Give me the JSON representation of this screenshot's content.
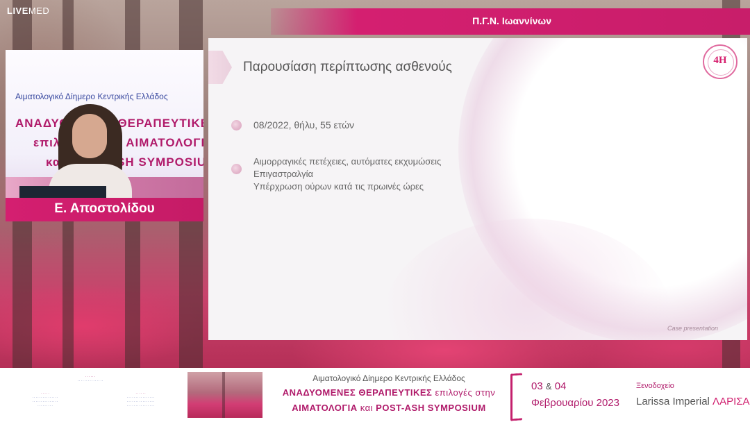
{
  "brand": {
    "bold": "LIVE",
    "light": "MED"
  },
  "header": {
    "hospital": "Π.Γ.Ν. Ιωαννίνων"
  },
  "presenter": {
    "name": "Ε. Αποστολίδου"
  },
  "webcam_poster": {
    "line1": "Αιματολογικό Δίημερο Κεντρικής Ελλάδος",
    "line2": "ΑΝΑΔΥΟΜΕΝΕΣ ΘΕΡΑΠΕΥΤΙΚΕΣ",
    "line3": "επιλογές στην ΑΙΜΑΤΟΛΟΓΙΑ",
    "line4": "και POST-ASH SYMPOSIUM"
  },
  "slide": {
    "title": "Παρουσίαση περίπτωσης ασθενούς",
    "logo_text": "4H",
    "bullet1": "08/2022, θήλυ, 55 ετών",
    "bullet2_lines": [
      "Αιμορραγικές πετέχειες, αυτόματες εκχυμώσεις",
      "Επιγαστραλγία",
      "Υπέρχρωση ούρων κατά τις πρωινές ώρες"
    ],
    "footer": "Case presentation"
  },
  "banner": {
    "subtitle": "Αιματολογικό Δίημερο Κεντρικής Ελλάδος",
    "main_line1_bold": "ΑΝΑΔΥΟΜΕΝΕΣ ΘΕΡΑΠΕΥΤΙΚΕΣ",
    "main_line1_thin": "επιλογές στην",
    "main_line2_a": "ΑΙΜΑΤΟΛΟΓΙΑ",
    "main_line2_thin": "και",
    "main_line2_b": "POST-ASH SYMPOSIUM",
    "date_days_a": "03",
    "date_amp": "&",
    "date_days_b": "04",
    "date_month": "Φεβρουαρίου",
    "date_year": "2023",
    "venue_label": "Ξενοδοχείο",
    "venue_name": "Larissa Imperial",
    "venue_city": "ΛΑΡΙΣΑ"
  },
  "colors": {
    "accent": "#d41f70",
    "title_text": "#555555",
    "bullet": "#e2b4ca"
  }
}
